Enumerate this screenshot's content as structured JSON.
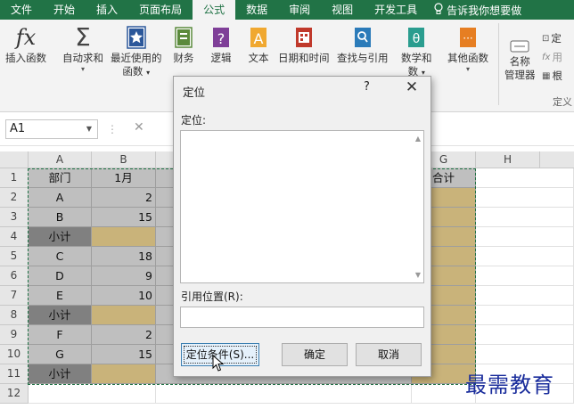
{
  "tabs": [
    "文件",
    "开始",
    "插入",
    "页面布局",
    "公式",
    "数据",
    "审阅",
    "视图",
    "开发工具"
  ],
  "active_tab": "公式",
  "tell_me": "告诉我你想要做",
  "ribbon": {
    "insert_function": "插入函数",
    "autosum": "自动求和",
    "recent_1": "最近使用的",
    "recent_2": "函数",
    "financial": "财务",
    "logical": "逻辑",
    "text": "文本",
    "datetime": "日期和时间",
    "lookup": "查找与引用",
    "math_1": "数学和",
    "math_2": "数",
    "more": "其他函数",
    "name_mgr_1": "名称",
    "name_mgr_2": "管理器",
    "define_name": "定",
    "use_in_formula": "用",
    "create_from_sel": "根",
    "group_defined": "定义"
  },
  "namebox": "A1",
  "columns": [
    "A",
    "B",
    "G",
    "H"
  ],
  "rows": [
    "1",
    "2",
    "3",
    "4",
    "5",
    "6",
    "7",
    "8",
    "9",
    "10",
    "11",
    "12"
  ],
  "colA": [
    "部门",
    "A",
    "B",
    "小计",
    "C",
    "D",
    "E",
    "小计",
    "F",
    "G",
    "小计"
  ],
  "colB": [
    "1月",
    "2",
    "15",
    "",
    "18",
    "9",
    "10",
    "",
    "2",
    "15",
    ""
  ],
  "colG_header": "合计",
  "dialog": {
    "title": "定位",
    "help": "?",
    "close": "✕",
    "goto_label": "定位:",
    "ref_label": "引用位置(R):",
    "special_button": "定位条件(S)...",
    "ok_button": "确定",
    "cancel_button": "取消"
  },
  "watermark": "最需教育",
  "colors": {
    "accent": "#217346",
    "dark_gray": "#808080",
    "light_gray": "#bfbfbf",
    "tan": "#c9b37a"
  }
}
